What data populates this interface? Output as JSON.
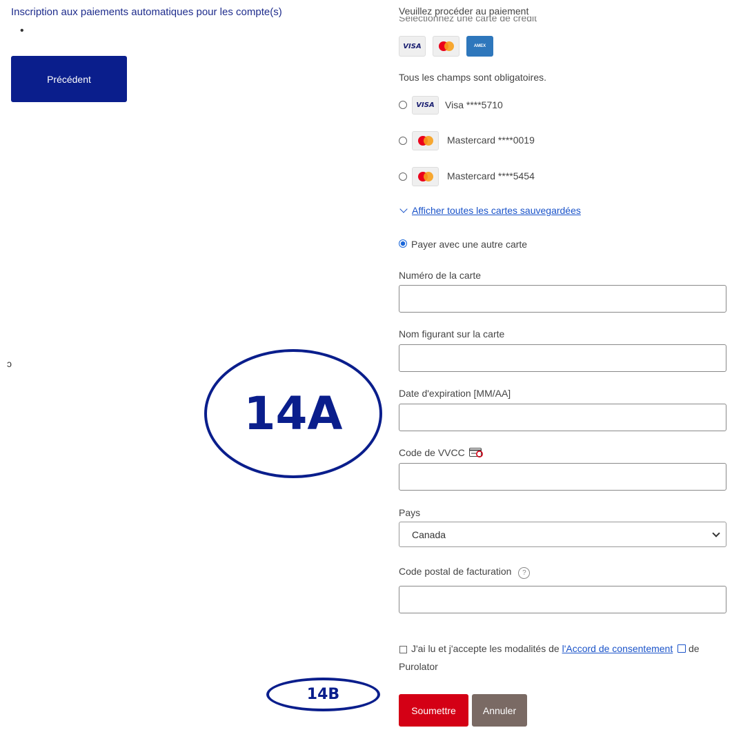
{
  "left_panel": {
    "title": "Inscription aux paiements automatiques pour les compte(s)",
    "bullet": "•",
    "previous_button": "Précédent",
    "stray_glyph": "ͻ"
  },
  "annotations": {
    "a": "14A",
    "b": "14B"
  },
  "payment_form": {
    "heading": "Veuillez procéder au paiement",
    "select_card_cut": "Sélectionnez une carte de crédit",
    "accepted_brands": [
      "VISA",
      "Mastercard",
      "AMEX"
    ],
    "required_note": "Tous les champs sont obligatoires.",
    "saved_cards": [
      {
        "brand_icon": "visa-icon",
        "brand": "Visa",
        "number": "****5710"
      },
      {
        "brand_icon": "mastercard-icon",
        "brand": "Mastercard",
        "number": "****0019"
      },
      {
        "brand_icon": "mastercard-icon",
        "brand": "Mastercard",
        "number": "****5454"
      }
    ],
    "show_all_cards": "Afficher toutes les cartes sauvegardées",
    "other_card_option": "Payer avec une autre carte",
    "fields": {
      "card_number": {
        "label": "Numéro de la carte",
        "value": ""
      },
      "card_name": {
        "label": "Nom figurant sur la carte",
        "value": ""
      },
      "expiry": {
        "label": "Date d'expiration [MM/AA]",
        "value": ""
      },
      "cvv": {
        "label": "Code de VVCC",
        "value": ""
      },
      "country": {
        "label": "Pays",
        "value": "Canada"
      },
      "postal": {
        "label": "Code postal de facturation",
        "value": ""
      }
    },
    "consent": {
      "prefix": "J'ai lu et j'accepte les modalités de ",
      "link": "l'Accord de consentement",
      "suffix_line1": " de",
      "suffix_line2": "Purolator"
    },
    "submit_label": "Soumettre",
    "cancel_label": "Annuler"
  },
  "colors": {
    "brand_blue": "#0a1e8c",
    "submit_red": "#d40015",
    "cancel_brown": "#7a6a64",
    "link_blue": "#1a53c9"
  }
}
